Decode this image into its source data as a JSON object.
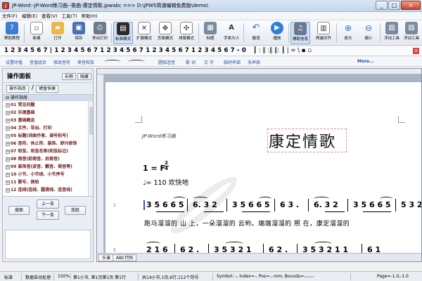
{
  "window": {
    "title": "JP-Word--JP-Word练习曲--歌曲-康定情歌.jpwabc ==> D:\\JPW5简谱编辑免费版\\demo\\",
    "controls": [
      "_",
      "□",
      "×"
    ]
  },
  "menu": [
    "文件(F)",
    "编辑(E)",
    "查看(V)",
    "工具(T)",
    "帮助(H)"
  ],
  "toolbar": {
    "buttons": [
      {
        "label": "帮助教程",
        "icon": "help-icon",
        "color": "#3c7fd0"
      },
      {
        "label": "新建",
        "icon": "new-doc-icon",
        "color": "#ffffff"
      },
      {
        "label": "打开",
        "icon": "open-folder-icon",
        "color": "#e8b84a"
      },
      {
        "label": "保存",
        "icon": "save-icon",
        "color": "#4a6fb5"
      },
      {
        "label": "导出打印",
        "icon": "print-icon",
        "color": "#6c7a8c"
      },
      {
        "label": "标准模式",
        "icon": "standard-mode-icon",
        "color": "#2b2b2b"
      },
      {
        "label": "扩展模式",
        "icon": "extended-mode-icon",
        "color": "#555555"
      },
      {
        "label": "页面模式",
        "icon": "page-mode-icon",
        "color": "#555555"
      },
      {
        "label": "排版模式",
        "icon": "layout-mode-icon",
        "color": "#555555"
      },
      {
        "label": "标题",
        "icon": "title-icon",
        "color": "#7a8aa0"
      },
      {
        "label": "字体大小",
        "icon": "font-size-icon",
        "color": "#333333"
      },
      {
        "label": "撤消",
        "icon": "undo-icon",
        "color": "#3a6fc0"
      },
      {
        "label": "播放",
        "icon": "play-icon",
        "color": "#2f7fd8"
      },
      {
        "label": "辅助信息",
        "icon": "assist-info-icon",
        "color": "#6a7890"
      },
      {
        "label": "两端对齐",
        "icon": "justify-icon",
        "color": "#555555"
      },
      {
        "label": "放大",
        "icon": "zoom-in-icon",
        "color": "#2f6fc8"
      },
      {
        "label": "缩小",
        "icon": "zoom-out-icon",
        "color": "#2f6fc8"
      },
      {
        "label": "浮动工具",
        "icon": "float-tools-icon",
        "color": "#7a8aa0"
      },
      {
        "label": "浮动工具",
        "icon": "float-tools-2-icon",
        "color": "#7a8aa0"
      }
    ]
  },
  "notebar": {
    "digits": "1 2 3 4 5 6 7 | 1 2 3 4 5 6 7 1 2 3 4 5 6 7 1 2 3 4 5 6 7 1 2 3 4 5 6 7 - 0",
    "extras": "┃ : ‖ :‖ ‖: ┃ | = \\ ▪ ▫"
  },
  "linkbar": [
    "设置时值",
    "音值组合",
    "修改音符",
    "倚音和弦",
    "圆弧连音",
    "歌 词",
    "文 字",
    "临时声部",
    "多声部",
    "More..."
  ],
  "leftpanel": {
    "title": "操作面板",
    "buttons": [
      "右侧",
      "隐藏"
    ],
    "tabs": [
      "操作指南",
      "键盘快捷"
    ],
    "tree_header": "操作指南",
    "tree": [
      "01 常见问题",
      "02 乐理基础",
      "03 基础概念",
      "04 文件、导出、打印",
      "05 标题(词曲作者、调号拍号)",
      "06 音符、休止符、装饰、即兴修饰",
      "07 和弦、和弦名称(和弦标记)",
      "08 倚音(前倚音、后倚音)",
      "09 装饰音(波音、颤音、倚音等)",
      "10 小节、小节线、小节序号",
      "11 歌号、换拍",
      "12 连线(连线、圆滑线、连音线)"
    ],
    "actions": [
      "搜索",
      "上一条",
      "下一条",
      "我就"
    ]
  },
  "document": {
    "source": "JP-Word练习曲",
    "title": "康定情歌",
    "key": "1 = F",
    "time_num": "2",
    "time_den": "4",
    "tempo": "♩= 110 欢快地",
    "line_numbers": [
      "1",
      "5"
    ],
    "measures_row1": [
      "3 5 6 6 5",
      "6. 3 2",
      "3 5 6 6 5",
      "6 3 .",
      "6. 3 2",
      "3 5 6 6 5",
      "5 3 2"
    ],
    "measures_row2": [
      "2 1 6",
      "6 2 .",
      "3 5 3 2 1",
      "6 2 .",
      "3 5 3 2 1 1",
      "6 1"
    ],
    "lyrics": "跑马溜溜的  山  上，一朵溜溜的  云哟。端端溜溜的  照    在，康定溜溜的",
    "tabs": [
      "乐谱",
      "ABC代码"
    ]
  },
  "statusbar": [
    "标准",
    "数据自动处理",
    "150%",
    "第1小节, 第1页第1页 第1行",
    "共14小节,1页,6行,112个符号",
    "Symbol: -, Index=-, Pos=-,-mm, Bounds=-,-,-,-",
    "Page=-1.0,-1.0"
  ]
}
